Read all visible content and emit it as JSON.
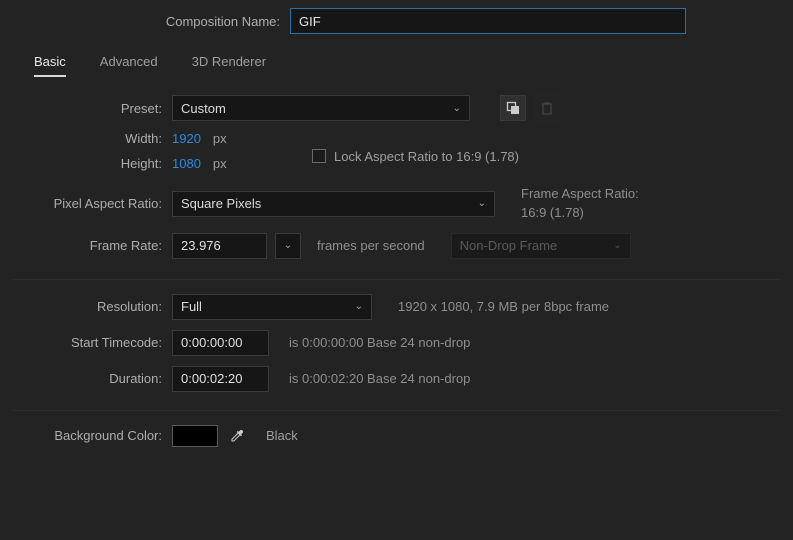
{
  "header": {
    "compNameLabel": "Composition Name:",
    "compNameValue": "GIF"
  },
  "tabs": {
    "basic": "Basic",
    "advanced": "Advanced",
    "renderer": "3D Renderer"
  },
  "preset": {
    "label": "Preset:",
    "value": "Custom"
  },
  "width": {
    "label": "Width:",
    "value": "1920",
    "unit": "px"
  },
  "height": {
    "label": "Height:",
    "value": "1080",
    "unit": "px"
  },
  "lockAspect": {
    "label": "Lock Aspect Ratio to 16:9 (1.78)"
  },
  "pixelAspect": {
    "label": "Pixel Aspect Ratio:",
    "value": "Square Pixels"
  },
  "frameAspect": {
    "label": "Frame Aspect Ratio:",
    "value": "16:9 (1.78)"
  },
  "frameRate": {
    "label": "Frame Rate:",
    "value": "23.976",
    "unit": "frames per second",
    "dropMode": "Non-Drop Frame"
  },
  "resolution": {
    "label": "Resolution:",
    "value": "Full",
    "info": "1920 x 1080, 7.9 MB per 8bpc frame"
  },
  "startTC": {
    "label": "Start Timecode:",
    "value": "0:00:00:00",
    "info": "is 0:00:00:00  Base 24  non-drop"
  },
  "duration": {
    "label": "Duration:",
    "value": "0:00:02:20",
    "info": "is 0:00:02:20  Base 24  non-drop"
  },
  "bg": {
    "label": "Background Color:",
    "colorName": "Black",
    "hex": "#000000"
  }
}
